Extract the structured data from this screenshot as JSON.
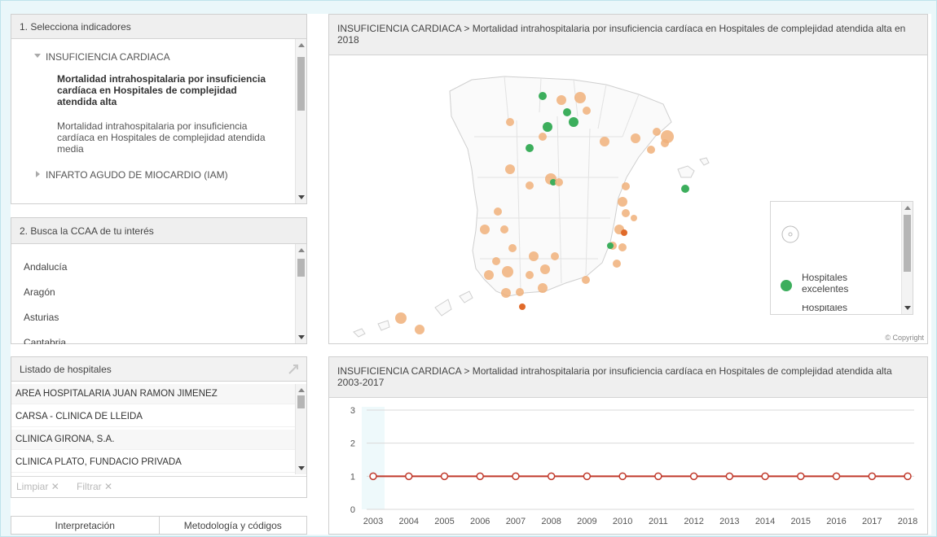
{
  "panel_indicators": {
    "title": "1. Selecciona indicadores",
    "root1": "INSUFICIENCIA CARDIACA",
    "item_selected": "Mortalidad intrahospitalaria por insuficiencia cardíaca en Hospitales de complejidad atendida alta",
    "item_other": "Mortalidad intrahospitalaria por insuficiencia cardíaca en Hospitales de complejidad atendida media",
    "root2": "INFARTO AGUDO DE MIOCARDIO (IAM)"
  },
  "panel_ccaa": {
    "title": "2. Busca la CCAA de tu interés",
    "items": [
      "Andalucía",
      "Aragón",
      "Asturias",
      "Cantabria"
    ]
  },
  "panel_hospitals": {
    "title": "Listado de hospitales",
    "items": [
      "AREA  HOSPITALARIA  JUAN RAMON JIMENEZ",
      "CARSA - CLINICA DE LLEIDA",
      "CLINICA GIRONA, S.A.",
      "CLINICA PLATO, FUNDACIO PRIVADA"
    ],
    "clear_label": "Limpiar",
    "filter_label": "Filtrar"
  },
  "bottom_tabs": [
    "Interpretación",
    "Metodología y códigos"
  ],
  "map_panel": {
    "title": "INSUFICIENCIA CARDIACA > Mortalidad intrahospitalaria por insuficiencia cardíaca en Hospitales de complejidad atendida alta en 2018",
    "copyright": "© Copyright",
    "legend_item1": "Hospitales excelentes",
    "legend_item2": "Hospitales"
  },
  "chart_panel": {
    "title": "INSUFICIENCIA CARDIACA > Mortalidad intrahospitalaria por insuficiencia cardíaca en Hospitales de complejidad atendida alta 2003-2017"
  },
  "colors": {
    "accent_line": "#c0392b",
    "green": "#3cae5c",
    "orange": "#f0b07a"
  },
  "chart_data": {
    "type": "line",
    "x": [
      "2003",
      "2004",
      "2005",
      "2006",
      "2007",
      "2008",
      "2009",
      "2010",
      "2011",
      "2012",
      "2013",
      "2014",
      "2015",
      "2016",
      "2017",
      "2018"
    ],
    "series": [
      {
        "values": [
          1,
          1,
          1,
          1,
          1,
          1,
          1,
          1,
          1,
          1,
          1,
          1,
          1,
          1,
          1,
          1
        ]
      }
    ],
    "ylim": [
      0,
      3
    ],
    "yticks": [
      "0",
      "1",
      "2",
      "3"
    ],
    "grid": true
  }
}
